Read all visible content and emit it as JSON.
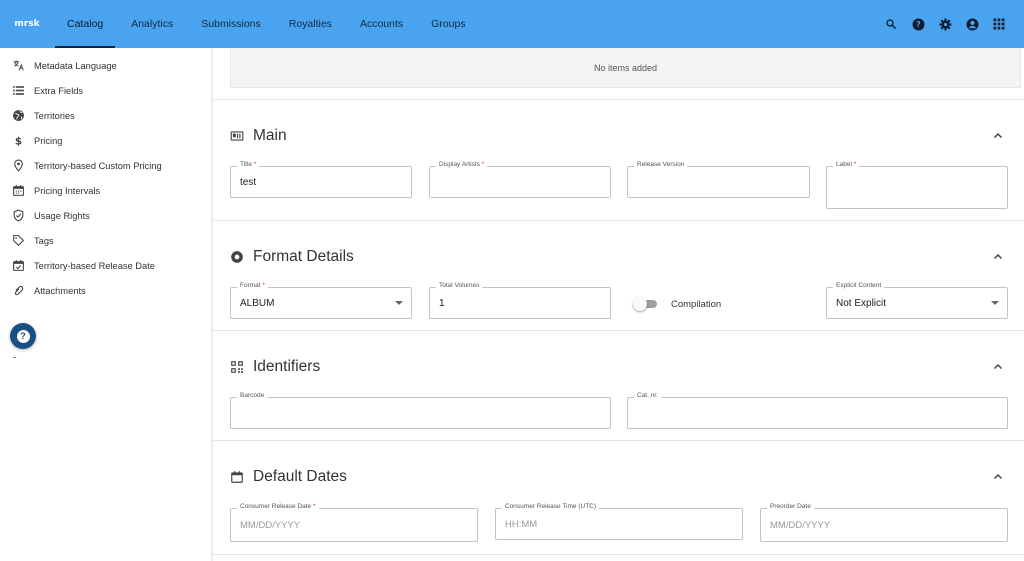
{
  "app": {
    "logo_text": "mrsk"
  },
  "nav": {
    "items": [
      {
        "label": "Catalog",
        "active": true
      },
      {
        "label": "Analytics"
      },
      {
        "label": "Submissions"
      },
      {
        "label": "Royalties"
      },
      {
        "label": "Accounts"
      },
      {
        "label": "Groups"
      }
    ],
    "icons": [
      "search-icon",
      "help-icon",
      "settings-icon",
      "account-icon",
      "apps-grid-icon"
    ]
  },
  "sidebar": {
    "items": [
      {
        "label": "Metadata Language",
        "icon": "translate-icon"
      },
      {
        "label": "Extra Fields",
        "icon": "list-icon"
      },
      {
        "label": "Territories",
        "icon": "globe-icon"
      },
      {
        "label": "Pricing",
        "icon": "dollar-icon"
      },
      {
        "label": "Territory-based Custom Pricing",
        "icon": "location-pin-icon"
      },
      {
        "label": "Pricing Intervals",
        "icon": "calendar-icon"
      },
      {
        "label": "Usage Rights",
        "icon": "shield-check-icon"
      },
      {
        "label": "Tags",
        "icon": "tag-icon"
      },
      {
        "label": "Territory-based Release Date",
        "icon": "calendar-check-icon"
      },
      {
        "label": "Attachments",
        "icon": "attachment-icon"
      }
    ],
    "help_label": "?"
  },
  "main": {
    "no_items": "No items added",
    "sections": {
      "main": {
        "title": "Main",
        "fields": {
          "title": {
            "label": "Title",
            "required": "*",
            "value": "test"
          },
          "display_artists": {
            "label": "Display Artists",
            "required": "*",
            "value": ""
          },
          "release_version": {
            "label": "Release Version",
            "value": ""
          },
          "label": {
            "label": "Label",
            "required": "*",
            "value": ""
          }
        }
      },
      "format": {
        "title": "Format Details",
        "fields": {
          "format": {
            "label": "Format",
            "required": "*",
            "value": "ALBUM"
          },
          "total_volumes": {
            "label": "Total Volumes",
            "value": "1"
          },
          "compilation": {
            "label": "Compilation",
            "on": false
          },
          "explicit": {
            "label": "Explicit Content",
            "value": "Not Explicit"
          }
        }
      },
      "identifiers": {
        "title": "Identifiers",
        "fields": {
          "barcode": {
            "label": "Barcode",
            "value": ""
          },
          "cat_nr": {
            "label": "Cat. nr.",
            "value": ""
          }
        }
      },
      "dates": {
        "title": "Default Dates",
        "fields": {
          "consumer_release_date": {
            "label": "Consumer Release Date",
            "required": "*",
            "placeholder": "MM/DD/YYYY"
          },
          "consumer_release_time": {
            "label": "Consumer Release Time (UTC)",
            "placeholder": "HH:MM"
          },
          "preorder_date": {
            "label": "Preorder Date",
            "placeholder": "MM/DD/YYYY"
          }
        }
      }
    }
  }
}
